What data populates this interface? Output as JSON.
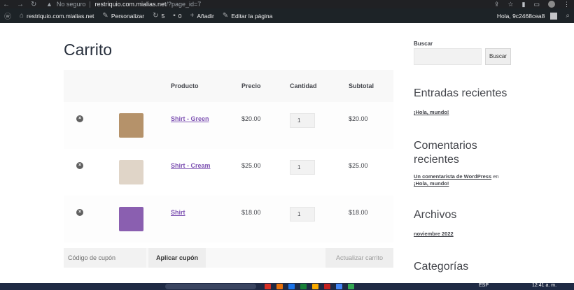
{
  "browser": {
    "security_label": "No seguro",
    "url_host": "restriquio.com.mialias.net",
    "url_path": "/?page_id=7"
  },
  "adminbar": {
    "site_name": "restriquio.com.mialias.net",
    "customize": "Personalizar",
    "updates_count": "5",
    "comments_count": "0",
    "add_new": "Añadir",
    "edit_page": "Editar la página",
    "greeting": "Hola, 9c2468cea8"
  },
  "page": {
    "title": "Carrito"
  },
  "cart": {
    "headers": {
      "product": "Producto",
      "price": "Precio",
      "quantity": "Cantidad",
      "subtotal": "Subtotal"
    },
    "items": [
      {
        "name": "Shirt - Green",
        "price": "$20.00",
        "qty": "1",
        "subtotal": "$20.00",
        "thumb_color": "#b5926a"
      },
      {
        "name": "Shirt - Cream",
        "price": "$25.00",
        "qty": "1",
        "subtotal": "$25.00",
        "thumb_color": "#e0d5c8"
      },
      {
        "name": "Shirt",
        "price": "$18.00",
        "qty": "1",
        "subtotal": "$18.00",
        "thumb_color": "#8a5fb0"
      }
    ],
    "coupon_placeholder": "Código de cupón",
    "apply_coupon": "Aplicar cupón",
    "update_cart": "Actualizar carrito"
  },
  "sidebar": {
    "search_label": "Buscar",
    "search_button": "Buscar",
    "recent_posts_title": "Entradas recientes",
    "recent_post_1": "¡Hola, mundo!",
    "recent_comments_title_1": "Comentarios",
    "recent_comments_title_2": "recientes",
    "comment_author": "Un comentarista de WordPress",
    "comment_on": "en",
    "comment_post": "¡Hola, mundo!",
    "archives_title": "Archivos",
    "archive_1": "noviembre 2022",
    "categories_title": "Categorías"
  },
  "taskbar": {
    "lang": "ESP",
    "time": "12:41 a. m."
  },
  "colors": {
    "link_purple": "#7f54b3",
    "adminbar_bg": "#1d2327",
    "chrome_bg": "#202124"
  }
}
